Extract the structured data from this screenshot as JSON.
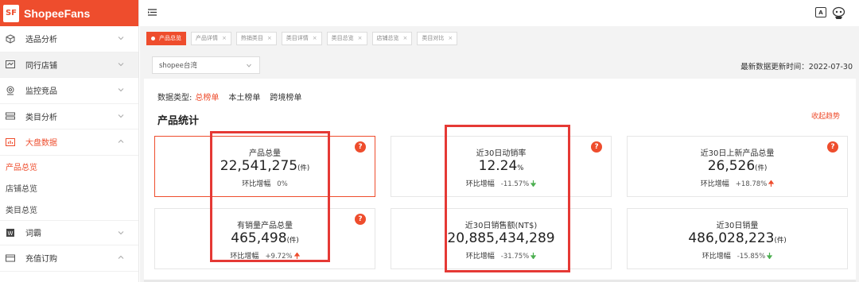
{
  "app": {
    "brand_logo": "SF",
    "brand_name": "ShopeeFans",
    "accent": "#ee4d2d"
  },
  "sidebar": {
    "items": [
      {
        "label": "选品分析",
        "icon": "cube-icon"
      },
      {
        "label": "同行店铺",
        "icon": "store-icon"
      },
      {
        "label": "监控竞品",
        "icon": "camera-icon"
      },
      {
        "label": "类目分析",
        "icon": "category-icon"
      },
      {
        "label": "大盘数据",
        "icon": "chart-icon"
      }
    ],
    "sub_items": [
      "产品总览",
      "店铺总览",
      "类目总览"
    ],
    "more_items": [
      {
        "label": "词霸",
        "icon": "word-icon"
      },
      {
        "label": "充值订购",
        "icon": "card-icon"
      }
    ]
  },
  "topbar": {
    "ai_label": "A"
  },
  "tabs": [
    {
      "label": "产品总览",
      "active": true
    },
    {
      "label": "产品详情",
      "active": false
    },
    {
      "label": "热销类目",
      "active": false
    },
    {
      "label": "类目详情",
      "active": false
    },
    {
      "label": "类目总览",
      "active": false
    },
    {
      "label": "店铺总览",
      "active": false
    },
    {
      "label": "类目对比",
      "active": false
    }
  ],
  "filter": {
    "site_select": "shopee台湾",
    "update_label": "最新数据更新时间：",
    "update_date": "2022-07-30"
  },
  "main": {
    "data_type_label": "数据类型:",
    "data_types": [
      "总榜单",
      "本土榜单",
      "跨境榜单"
    ],
    "section_title": "产品统计",
    "collapse_link": "收起趋势",
    "change_label": "环比增幅",
    "cards": [
      {
        "title": "产品总量",
        "value": "22,541,275",
        "unit": "(件)",
        "change": "0%",
        "trend": "none",
        "help": true
      },
      {
        "title": "近30日动销率",
        "value": "12.24",
        "unit": "%",
        "change": "-11.57%",
        "trend": "down",
        "help": true
      },
      {
        "title": "近30日上新产品总量",
        "value": "26,526",
        "unit": "(件)",
        "change": "+18.78%",
        "trend": "up",
        "help": true
      },
      {
        "title": "有销量产品总量",
        "value": "465,498",
        "unit": "(件)",
        "change": "+9.72%",
        "trend": "up",
        "help": true
      },
      {
        "title": "近30日销售额(NT$)",
        "value": "20,885,434,289",
        "unit": "",
        "change": "-31.75%",
        "trend": "down",
        "help": false
      },
      {
        "title": "近30日销量",
        "value": "486,028,223",
        "unit": "(件)",
        "change": "-15.85%",
        "trend": "down",
        "help": false
      }
    ]
  },
  "colors": {
    "up": "#ee4d2d",
    "down": "#4caf50",
    "annotation": "#e53935"
  }
}
